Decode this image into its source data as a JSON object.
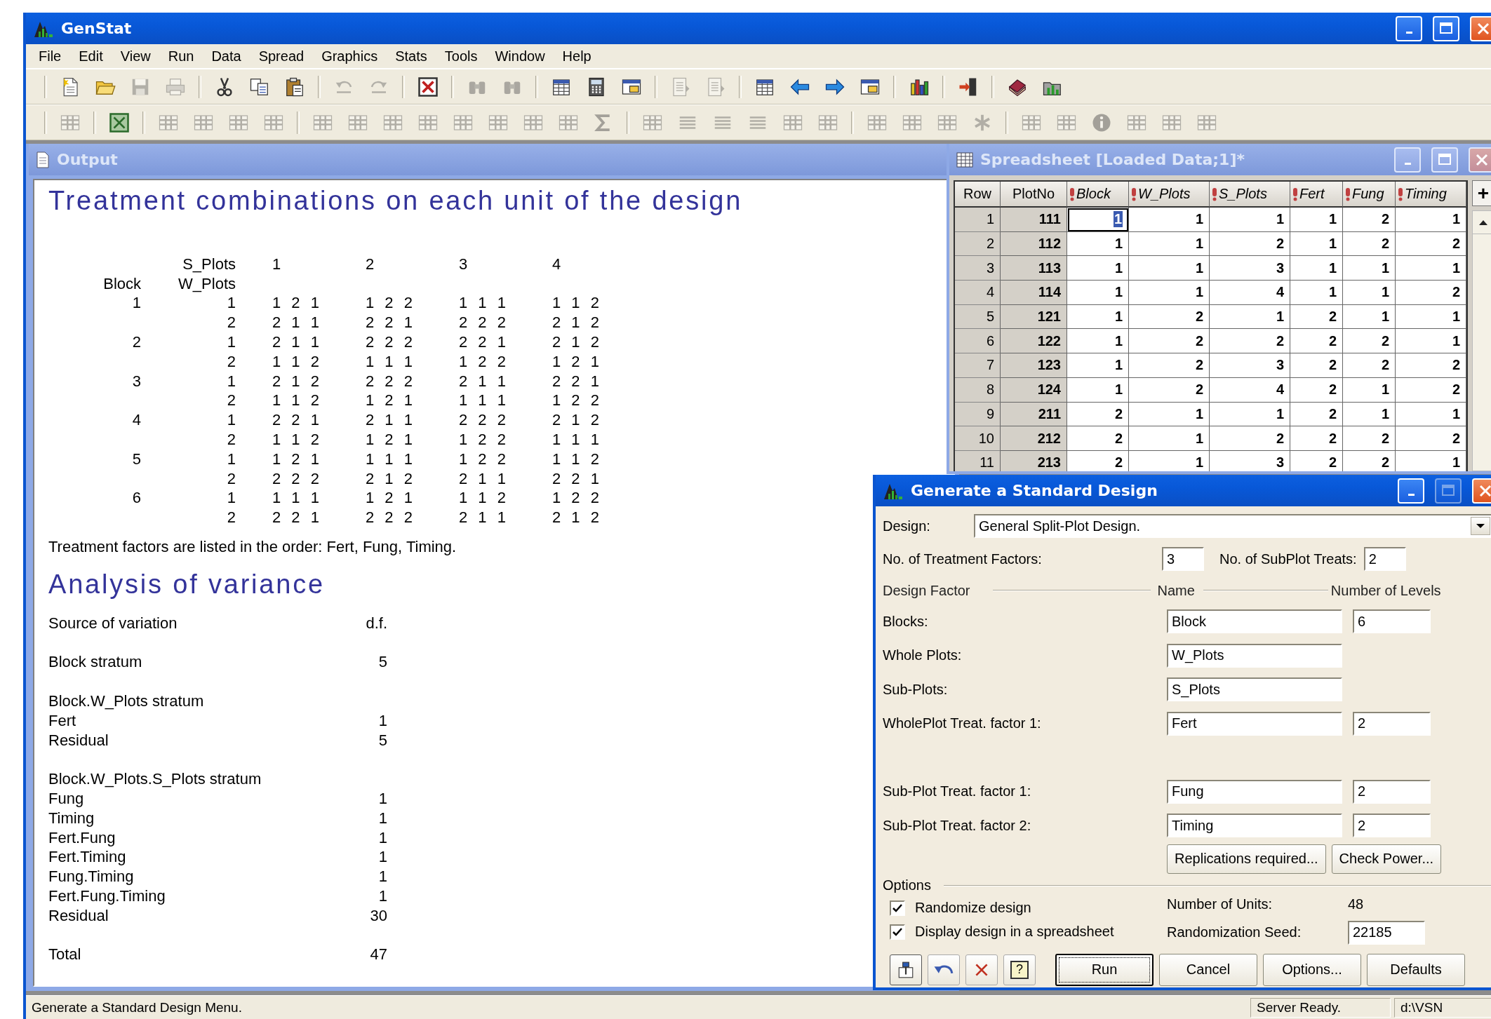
{
  "app": {
    "title": "GenStat",
    "active": true
  },
  "menu": [
    "File",
    "Edit",
    "View",
    "Run",
    "Data",
    "Spread",
    "Graphics",
    "Stats",
    "Tools",
    "Window",
    "Help"
  ],
  "toolbars": [
    {
      "groups": [
        [
          {
            "kind": "new",
            "disabled": false
          },
          {
            "kind": "open",
            "disabled": false
          },
          {
            "kind": "save",
            "disabled": true
          },
          {
            "kind": "print",
            "disabled": true
          }
        ],
        [
          {
            "kind": "cut",
            "disabled": false
          },
          {
            "kind": "copy",
            "disabled": false
          },
          {
            "kind": "paste",
            "disabled": false
          }
        ],
        [
          {
            "kind": "undo",
            "disabled": true
          },
          {
            "kind": "redo",
            "disabled": true
          }
        ],
        [
          {
            "kind": "closebox",
            "disabled": false
          }
        ],
        [
          {
            "kind": "find",
            "disabled": true
          },
          {
            "kind": "find",
            "disabled": true
          }
        ],
        [
          {
            "kind": "sheet",
            "disabled": false
          },
          {
            "kind": "calc",
            "disabled": false
          },
          {
            "kind": "window",
            "disabled": false
          }
        ],
        [
          {
            "kind": "doc",
            "disabled": true
          },
          {
            "kind": "doc",
            "disabled": true
          }
        ],
        [
          {
            "kind": "sheet",
            "disabled": false
          },
          {
            "kind": "left",
            "disabled": false
          },
          {
            "kind": "right",
            "disabled": false
          },
          {
            "kind": "window",
            "disabled": false
          }
        ],
        [
          {
            "kind": "chart",
            "disabled": false
          }
        ],
        [
          {
            "kind": "exit",
            "disabled": false
          }
        ],
        [
          {
            "kind": "book",
            "disabled": false
          },
          {
            "kind": "foldchart",
            "disabled": false
          }
        ]
      ]
    },
    {
      "groups": [
        [
          {
            "kind": "grid",
            "disabled": true
          }
        ],
        [
          {
            "kind": "xbox",
            "disabled": false
          }
        ],
        [
          {
            "kind": "grid",
            "disabled": true
          },
          {
            "kind": "grid",
            "disabled": true
          },
          {
            "kind": "grid",
            "disabled": true
          },
          {
            "kind": "grid",
            "disabled": true
          }
        ],
        [
          {
            "kind": "grid",
            "disabled": true
          },
          {
            "kind": "grid",
            "disabled": true
          },
          {
            "kind": "grid",
            "disabled": true
          },
          {
            "kind": "grid",
            "disabled": true
          },
          {
            "kind": "grid",
            "disabled": true
          },
          {
            "kind": "grid",
            "disabled": true
          },
          {
            "kind": "grid",
            "disabled": true
          },
          {
            "kind": "grid",
            "disabled": true
          },
          {
            "kind": "sigma",
            "disabled": true
          }
        ],
        [
          {
            "kind": "grid",
            "disabled": true
          },
          {
            "kind": "lines",
            "disabled": true
          },
          {
            "kind": "lines",
            "disabled": true
          },
          {
            "kind": "lines",
            "disabled": true
          },
          {
            "kind": "grid",
            "disabled": true
          },
          {
            "kind": "grid",
            "disabled": true
          }
        ],
        [
          {
            "kind": "grid",
            "disabled": true
          },
          {
            "kind": "grid",
            "disabled": true
          },
          {
            "kind": "grid",
            "disabled": true
          },
          {
            "kind": "star",
            "disabled": true
          }
        ],
        [
          {
            "kind": "grid",
            "disabled": true
          },
          {
            "kind": "grid",
            "disabled": true
          },
          {
            "kind": "info",
            "disabled": true
          },
          {
            "kind": "grid",
            "disabled": true
          },
          {
            "kind": "grid",
            "disabled": true
          },
          {
            "kind": "grid",
            "disabled": true
          }
        ]
      ]
    }
  ],
  "output": {
    "title": "Output",
    "active": false,
    "heading": "Treatment combinations on each unit of the design",
    "design_table": {
      "column_header": "S_Plots",
      "columns": [
        "1",
        "2",
        "3",
        "4"
      ],
      "row_header": "Block",
      "subrow_header": "W_Plots",
      "rows": [
        {
          "block": "1",
          "w_plot": "1",
          "cells": [
            "1 2 1",
            "1 2 2",
            "1 1 1",
            "1 1 2"
          ]
        },
        {
          "w_plot": "2",
          "cells": [
            "2 1 1",
            "2 2 1",
            "2 2 2",
            "2 1 2"
          ]
        },
        {
          "block": "2",
          "w_plot": "1",
          "cells": [
            "2 1 1",
            "2 2 2",
            "2 2 1",
            "2 1 2"
          ]
        },
        {
          "w_plot": "2",
          "cells": [
            "1 1 2",
            "1 1 1",
            "1 2 2",
            "1 2 1"
          ]
        },
        {
          "block": "3",
          "w_plot": "1",
          "cells": [
            "2 1 2",
            "2 2 2",
            "2 1 1",
            "2 2 1"
          ]
        },
        {
          "w_plot": "2",
          "cells": [
            "1 1 2",
            "1 2 1",
            "1 1 1",
            "1 2 2"
          ]
        },
        {
          "block": "4",
          "w_plot": "1",
          "cells": [
            "2 2 1",
            "2 1 1",
            "2 2 2",
            "2 1 2"
          ]
        },
        {
          "w_plot": "2",
          "cells": [
            "1 1 2",
            "1 2 1",
            "1 2 2",
            "1 1 1"
          ]
        },
        {
          "block": "5",
          "w_plot": "1",
          "cells": [
            "1 2 1",
            "1 1 1",
            "1 2 2",
            "1 1 2"
          ]
        },
        {
          "w_plot": "2",
          "cells": [
            "2 2 2",
            "2 1 2",
            "2 1 1",
            "2 2 1"
          ]
        },
        {
          "block": "6",
          "w_plot": "1",
          "cells": [
            "1 1 1",
            "1 2 1",
            "1 1 2",
            "1 2 2"
          ]
        },
        {
          "w_plot": "2",
          "cells": [
            "2 2 1",
            "2 2 2",
            "2 1 1",
            "2 1 2"
          ]
        }
      ]
    },
    "note": "Treatment factors are listed in the order: Fert, Fung, Timing.",
    "anova_heading": "Analysis of variance",
    "anova": [
      {
        "kind": "header",
        "source": "Source of variation",
        "df": "d.f."
      },
      {
        "kind": "stratum",
        "source": "Block stratum",
        "df": "5"
      },
      {
        "kind": "stratum",
        "source": "Block.W_Plots stratum"
      },
      {
        "kind": "term",
        "source": "Fert",
        "df": "1"
      },
      {
        "kind": "term",
        "source": "Residual",
        "df": "5"
      },
      {
        "kind": "stratum",
        "source": "Block.W_Plots.S_Plots stratum"
      },
      {
        "kind": "term",
        "source": "Fung",
        "df": "1"
      },
      {
        "kind": "term",
        "source": "Timing",
        "df": "1"
      },
      {
        "kind": "term",
        "source": "Fert.Fung",
        "df": "1"
      },
      {
        "kind": "term",
        "source": "Fert.Timing",
        "df": "1"
      },
      {
        "kind": "term",
        "source": "Fung.Timing",
        "df": "1"
      },
      {
        "kind": "term",
        "source": "Fert.Fung.Timing",
        "df": "1"
      },
      {
        "kind": "term",
        "source": "Residual",
        "df": "30"
      },
      {
        "kind": "total",
        "source": "Total",
        "df": "47"
      }
    ]
  },
  "spreadsheet": {
    "title": "Spreadsheet [Loaded Data;1]*",
    "active": false,
    "add_button": "+",
    "columns": [
      {
        "name": "Row",
        "kind": "index"
      },
      {
        "name": "PlotNo",
        "kind": "label"
      },
      {
        "name": "Block",
        "kind": "factor"
      },
      {
        "name": "W_Plots",
        "kind": "factor"
      },
      {
        "name": "S_Plots",
        "kind": "factor"
      },
      {
        "name": "Fert",
        "kind": "factor"
      },
      {
        "name": "Fung",
        "kind": "factor"
      },
      {
        "name": "Timing",
        "kind": "factor"
      }
    ],
    "rows": [
      {
        "selected": true,
        "cells": [
          "1",
          "111",
          "1",
          "1",
          "1",
          "1",
          "2",
          "1"
        ]
      },
      {
        "selected": false,
        "cells": [
          "2",
          "112",
          "1",
          "1",
          "2",
          "1",
          "2",
          "2"
        ]
      },
      {
        "selected": false,
        "cells": [
          "3",
          "113",
          "1",
          "1",
          "3",
          "1",
          "1",
          "1"
        ]
      },
      {
        "selected": false,
        "cells": [
          "4",
          "114",
          "1",
          "1",
          "4",
          "1",
          "1",
          "2"
        ]
      },
      {
        "selected": false,
        "cells": [
          "5",
          "121",
          "1",
          "2",
          "1",
          "2",
          "1",
          "1"
        ]
      },
      {
        "selected": false,
        "cells": [
          "6",
          "122",
          "1",
          "2",
          "2",
          "2",
          "2",
          "1"
        ]
      },
      {
        "selected": false,
        "cells": [
          "7",
          "123",
          "1",
          "2",
          "3",
          "2",
          "2",
          "2"
        ]
      },
      {
        "selected": false,
        "cells": [
          "8",
          "124",
          "1",
          "2",
          "4",
          "2",
          "1",
          "2"
        ]
      },
      {
        "selected": false,
        "cells": [
          "9",
          "211",
          "2",
          "1",
          "1",
          "2",
          "1",
          "1"
        ]
      },
      {
        "selected": false,
        "cells": [
          "10",
          "212",
          "2",
          "1",
          "2",
          "2",
          "2",
          "2"
        ]
      },
      {
        "selected": false,
        "cells": [
          "11",
          "213",
          "2",
          "1",
          "3",
          "2",
          "2",
          "1"
        ]
      }
    ]
  },
  "dialog": {
    "title": "Generate a Standard Design",
    "active": true,
    "controls": [
      {
        "kind": "minimize",
        "disabled": false
      },
      {
        "kind": "maximize",
        "disabled": true
      },
      {
        "kind": "close",
        "disabled": false
      }
    ],
    "design_label": "Design:",
    "design_value": "General Split-Plot Design.",
    "treatment_factors_label": "No. of Treatment Factors:",
    "treatment_factors_value": "3",
    "subplot_treats_label": "No. of SubPlot Treats:",
    "subplot_treats_value": "2",
    "headers": [
      "Design Factor",
      "Name",
      "Number of Levels"
    ],
    "factors": [
      {
        "kind": "structure",
        "label": "Blocks:",
        "name": "Block",
        "levels": "6"
      },
      {
        "kind": "structure",
        "label": "Whole Plots:",
        "name": "W_Plots"
      },
      {
        "kind": "structure",
        "label": "Sub-Plots:",
        "name": "S_Plots"
      },
      {
        "kind": "wholeplot-treatment",
        "label": "WholePlot Treat. factor 1:",
        "name": "Fert",
        "levels": "2"
      },
      {
        "kind": "subplot-treatment",
        "label": "Sub-Plot Treat. factor 1:",
        "name": "Fung",
        "levels": "2"
      },
      {
        "kind": "subplot-treatment",
        "label": "Sub-Plot Treat. factor 2:",
        "name": "Timing",
        "levels": "2"
      }
    ],
    "action_buttons": [
      "Replications required...",
      "Check Power..."
    ],
    "options_label": "Options",
    "checkboxes": [
      {
        "label": "Randomize design",
        "checked": true
      },
      {
        "label": "Display design in a spreadsheet",
        "checked": true
      }
    ],
    "units_label": "Number of Units:",
    "units_value": "48",
    "seed_label": "Randomization Seed:",
    "seed_value": "22185",
    "tools": [
      {
        "kind": "pin"
      },
      {
        "kind": "undo"
      },
      {
        "kind": "clear"
      },
      {
        "kind": "help",
        "label": "?"
      }
    ],
    "buttons": [
      {
        "label": "Run",
        "default": true
      },
      {
        "label": "Cancel",
        "default": false
      },
      {
        "label": "Options...",
        "default": false
      },
      {
        "label": "Defaults",
        "default": false
      }
    ]
  },
  "status_bar": {
    "message": "Generate a Standard Design Menu.",
    "panels": [
      "Server Ready.",
      "d:\\VSN"
    ]
  }
}
